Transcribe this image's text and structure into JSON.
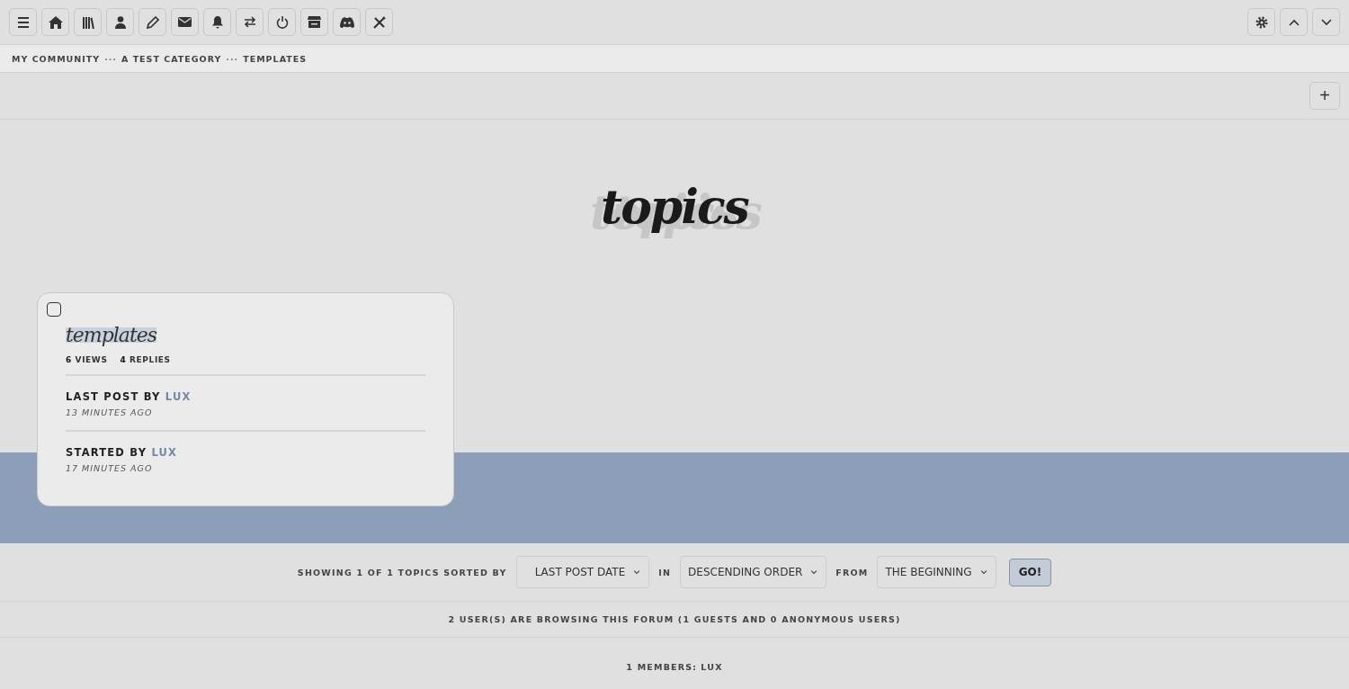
{
  "breadcrumb": [
    {
      "kind": "link",
      "text": "MY COMMUNITY"
    },
    {
      "kind": "sep",
      "text": "···"
    },
    {
      "kind": "link",
      "text": "A TEST CATEGORY"
    },
    {
      "kind": "sep",
      "text": "···"
    },
    {
      "kind": "link",
      "text": "TEMPLATES"
    }
  ],
  "new_topic_button": "+",
  "heading": "topics",
  "topic": {
    "checked": false,
    "title": "templates",
    "views": "6",
    "views_label": "VIEWS",
    "replies": "4",
    "replies_label": "REPLIES",
    "last_post_label": "LAST POST BY",
    "last_post_user": "LUX",
    "last_post_time": "13 MINUTES AGO",
    "started_label": "STARTED BY",
    "started_user": "LUX",
    "started_time": "17 MINUTES AGO"
  },
  "sort_bar": {
    "showing": "SHOWING 1 OF 1 TOPICS SORTED BY",
    "sort_by": "LAST POST DATE",
    "in_label": "IN",
    "order": "DESCENDING ORDER",
    "from_label": "FROM",
    "from": "THE BEGINNING",
    "go": "GO!"
  },
  "browsing": "2 USER(S) ARE BROWSING THIS FORUM (1 GUESTS AND 0 ANONYMOUS USERS)",
  "members_label": "1 MEMBERS:",
  "members": [
    "LUX"
  ]
}
